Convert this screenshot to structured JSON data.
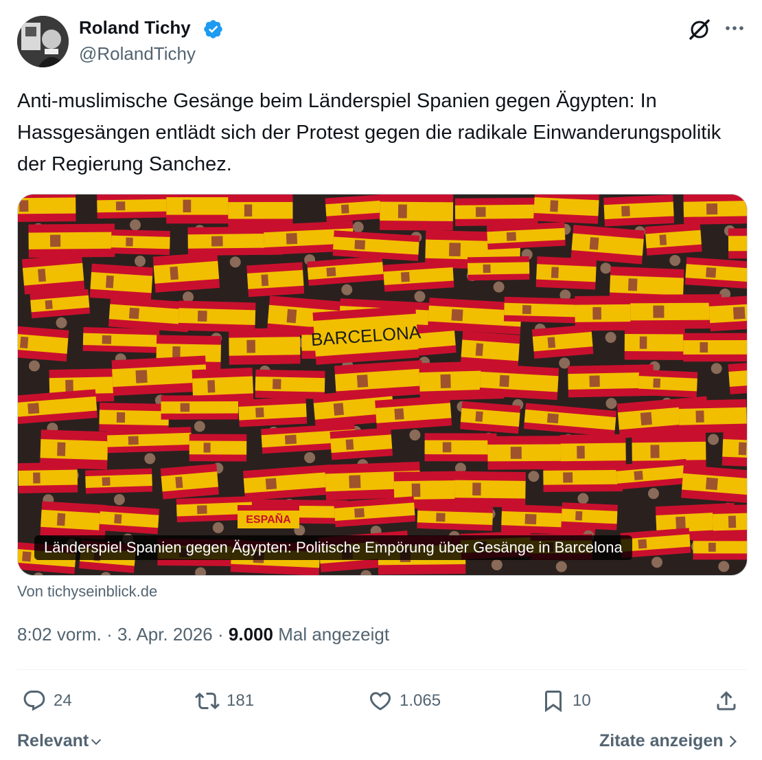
{
  "author": {
    "name": "Roland Tichy",
    "handle": "@RolandTichy",
    "verified": true
  },
  "tweet": {
    "text": "Anti-muslimische Gesänge beim Länderspiel Spanien gegen Ägypten: In Hassgesängen entlädt sich der Protest gegen die radikale Einwanderungspolitik der Regierung Sanchez."
  },
  "card": {
    "caption": "Länderspiel Spanien gegen Ägypten: Politische Empörung über Gesänge in Barcelona",
    "source": "Von tichyseinblick.de"
  },
  "meta": {
    "time": "8:02 vorm.",
    "separator": "·",
    "date": "3. Apr. 2026",
    "views": "9.000",
    "views_label": "Mal angezeigt"
  },
  "actions": {
    "replies": "24",
    "reposts": "181",
    "likes": "1.065",
    "bookmarks": "10"
  },
  "footer": {
    "sort_label": "Relevant",
    "quotes_label": "Zitate anzeigen"
  },
  "icons": {
    "verified": "verified-badge-icon",
    "grok": "grok-icon",
    "more": "more-icon",
    "reply": "reply-icon",
    "repost": "repost-icon",
    "like": "heart-icon",
    "bookmark": "bookmark-icon",
    "share": "share-icon",
    "chevron_down": "chevron-down-icon",
    "chevron_right": "chevron-right-icon"
  },
  "colors": {
    "text_primary": "#0f1419",
    "text_secondary": "#536471",
    "verified_blue": "#1d9bf0",
    "flag_red": "#c8102e",
    "flag_yellow": "#f1bf00"
  }
}
